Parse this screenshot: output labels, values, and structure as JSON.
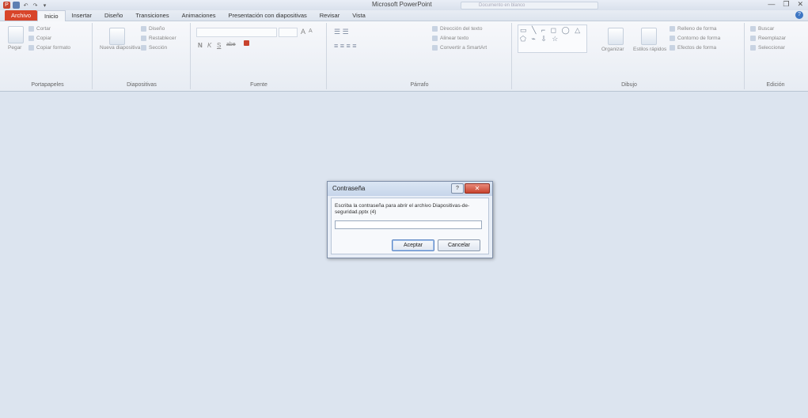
{
  "titlebar": {
    "app_title": "Microsoft PowerPoint",
    "search_placeholder": "Documento en blanco",
    "minimize": "—",
    "restore": "❐",
    "close": "✕"
  },
  "tabs": [
    {
      "label": "Archivo"
    },
    {
      "label": "Inicio"
    },
    {
      "label": "Insertar"
    },
    {
      "label": "Diseño"
    },
    {
      "label": "Transiciones"
    },
    {
      "label": "Animaciones"
    },
    {
      "label": "Presentación con diapositivas"
    },
    {
      "label": "Revisar"
    },
    {
      "label": "Vista"
    }
  ],
  "ribbon": {
    "clipboard": {
      "label": "Portapapeles",
      "paste": "Pegar",
      "cut": "Cortar",
      "copy": "Copiar",
      "format_painter": "Copiar formato"
    },
    "slides": {
      "label": "Diapositivas",
      "new_slide": "Nueva diapositiva",
      "layout": "Diseño",
      "reset": "Restablecer",
      "section": "Sección"
    },
    "font": {
      "label": "Fuente",
      "bold": "N",
      "italic": "K",
      "underline": "S",
      "strike": "abe",
      "size_up": "A",
      "size_down": "A"
    },
    "paragraph": {
      "label": "Párrafo",
      "text_direction": "Dirección del texto",
      "align_text": "Alinear texto",
      "smartart": "Convertir a SmartArt"
    },
    "drawing": {
      "label": "Dibujo",
      "arrange": "Organizar",
      "quick_styles": "Estilos rápidos",
      "shape_fill": "Relleno de forma",
      "shape_outline": "Contorno de forma",
      "shape_effects": "Efectos de forma"
    },
    "editing": {
      "label": "Edición",
      "find": "Buscar",
      "replace": "Reemplazar",
      "select": "Seleccionar"
    }
  },
  "dialog": {
    "title": "Contraseña",
    "help": "?",
    "close": "✕",
    "prompt": "Escriba la contraseña para abrir el archivo Diapositivas-de-seguridad.pptx (4)",
    "input_value": "",
    "ok": "Aceptar",
    "cancel": "Cancelar"
  }
}
